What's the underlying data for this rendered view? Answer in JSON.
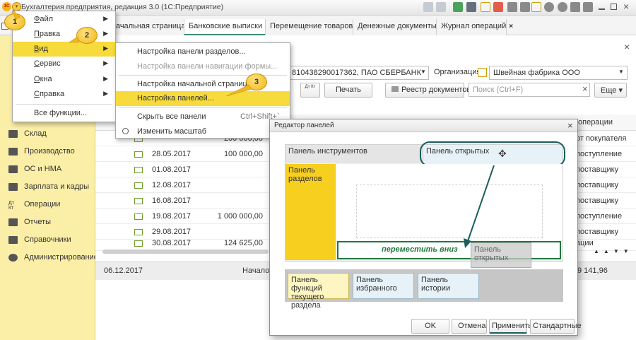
{
  "titlebar": {
    "title": "Бухгалтерия предприятия, редакция 3.0  (1С:Предприятие)",
    "logo": "1С"
  },
  "tabs": [
    {
      "label": "Начальная страница",
      "active": false,
      "closable": false
    },
    {
      "label": "Банковские выписки",
      "active": true,
      "closable": true
    },
    {
      "label": "Перемещение товаров",
      "active": false,
      "closable": true
    },
    {
      "label": "Денежные документы",
      "active": false,
      "closable": true
    },
    {
      "label": "Журнал операций",
      "active": false,
      "closable": true
    }
  ],
  "tab_close_glyph": "×",
  "sidebar": {
    "items": [
      {
        "label": "Склад",
        "icon": "warehouse-icon"
      },
      {
        "label": "Производство",
        "icon": "factory-icon"
      },
      {
        "label": "ОС и НМА",
        "icon": "truck-icon"
      },
      {
        "label": "Зарплата и кадры",
        "icon": "people-icon"
      },
      {
        "label": "Операции",
        "icon": "operations-icon"
      },
      {
        "label": "Отчеты",
        "icon": "chart-icon"
      },
      {
        "label": "Справочники",
        "icon": "books-icon"
      },
      {
        "label": "Администрирование",
        "icon": "gear-icon"
      }
    ]
  },
  "main_menu": {
    "items": [
      {
        "label": "Файл",
        "underline": "Ф",
        "rest": "айл",
        "submenu": true
      },
      {
        "label": "Правка",
        "underline": "П",
        "rest": "равка",
        "submenu": true
      },
      {
        "label": "Вид",
        "underline": "В",
        "rest": "ид",
        "submenu": true,
        "selected": true
      },
      {
        "label": "Сервис",
        "underline": "С",
        "rest": "ервис",
        "submenu": true
      },
      {
        "label": "Окна",
        "underline": "О",
        "rest": "кна",
        "submenu": true
      },
      {
        "label": "Справка",
        "underline": "С",
        "rest": "правка",
        "submenu": true
      },
      {
        "label": "Все функции..."
      }
    ]
  },
  "view_menu": {
    "items": [
      {
        "label": "Настройка панели разделов...",
        "disabled": false
      },
      {
        "label": "Настройка панели навигации формы...",
        "disabled": true
      },
      {
        "label": "Настройка начальной страницы...",
        "disabled": false
      },
      {
        "label": "Настройка панелей...",
        "disabled": false,
        "selected": true
      },
      {
        "label": "Скрыть все панели",
        "shortcut": "Ctrl+Shift+`"
      },
      {
        "label": "Изменить масштаб",
        "icon": "zoom-icon"
      }
    ]
  },
  "callouts": [
    "1",
    "2",
    "3"
  ],
  "toolbar": {
    "account_value": "810438290017362, ПАО СБЕРБАНК",
    "org_label": "Организация:",
    "org_value": "Швейная фабрика ООО",
    "dtkt_label": "Дт Кт",
    "print_button": "Печать",
    "registry_button": "Реестр документов",
    "search_placeholder": "Поиск (Ctrl+F)",
    "clear_glyph": "×",
    "more_button": "Еще ▾"
  },
  "table": {
    "rows": [
      {
        "date": "",
        "amount": "200 000,00"
      },
      {
        "date": "28.05.2017",
        "amount": "100 000,00"
      },
      {
        "date": "01.08.2017",
        "amount": ""
      },
      {
        "date": "12.08.2017",
        "amount": ""
      },
      {
        "date": "16.08.2017",
        "amount": ""
      },
      {
        "date": "19.08.2017",
        "amount": "1 000 000,00"
      },
      {
        "date": "29.08.2017",
        "amount": ""
      },
      {
        "date": "30.08.2017",
        "amount": "124 625,00"
      }
    ],
    "right_header": "операции",
    "right_rows": [
      "от покупателя",
      "поступление",
      "поставщику",
      "поставщику",
      "поставщику",
      "поступление",
      "поставщику",
      "ации"
    ],
    "footer_date": "06.12.2017",
    "footer_mid": "Начало д",
    "footer_right": "9 141,96"
  },
  "dialog": {
    "title": "Редактор панелей",
    "close_glyph": "×",
    "tools_panel": "Панель инструментов",
    "open_panel": "Панель открытых",
    "sections_panel": "Панель разделов",
    "move_hint": "переместить вниз",
    "open_panel_ghost": "Панель открытых",
    "functions_panel": "Панель функций текущего раздела",
    "favorites_panel": "Панель избранного",
    "history_panel": "Панель истории",
    "ok": "OK",
    "cancel": "Отмена",
    "apply": "Применить",
    "defaults": "Стандартные"
  },
  "colors": {
    "accent_yellow": "#f7da3b",
    "sidebar_bg": "#fbeea7",
    "green": "#1e7a3c",
    "dark_teal": "#1b5e5a",
    "light_blue": "#e6f2f7"
  }
}
